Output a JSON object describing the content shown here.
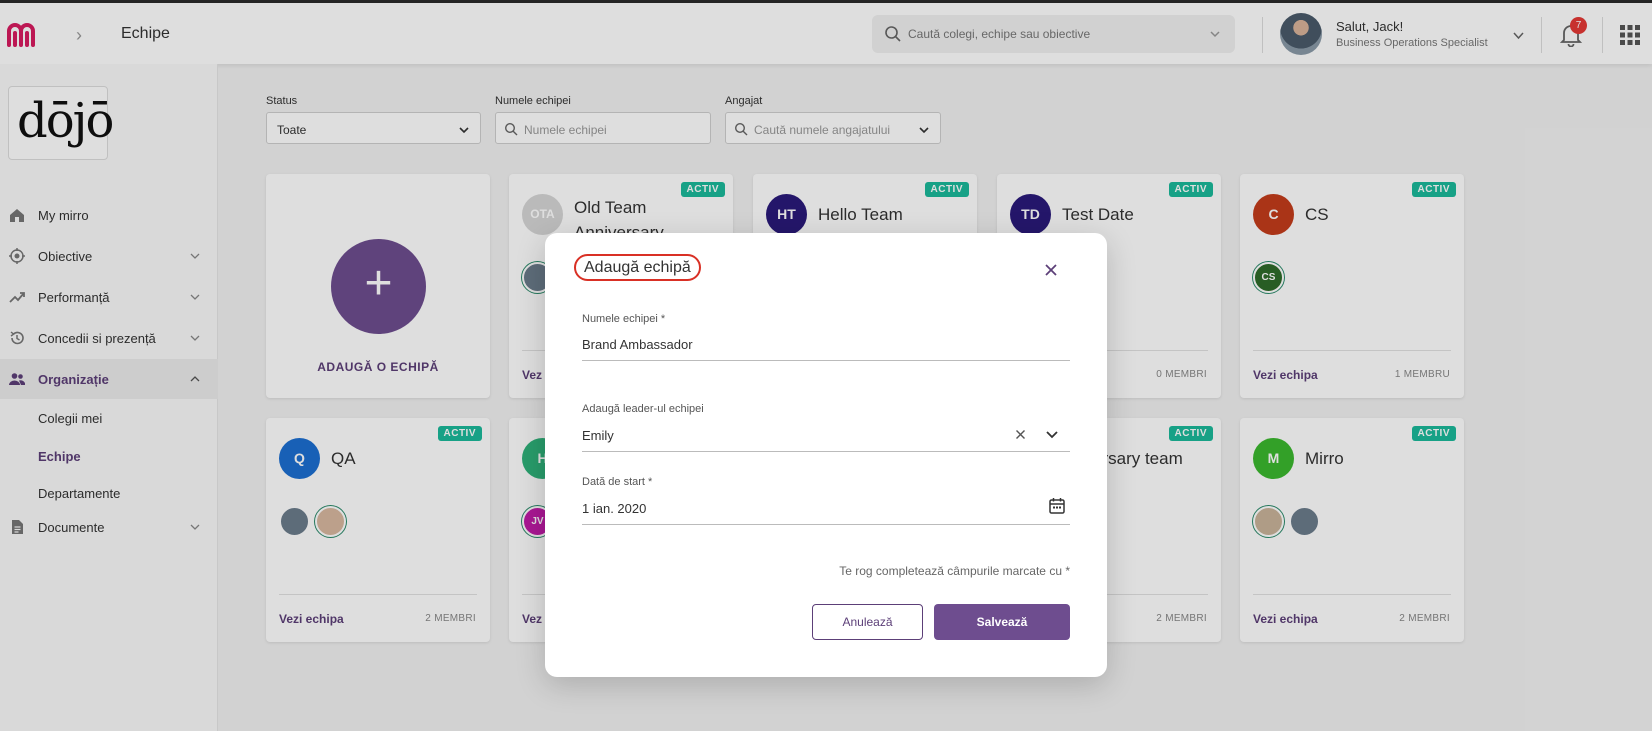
{
  "header": {
    "page_title": "Echipe",
    "search_placeholder": "Caută colegi, echipe sau obiective",
    "user_greeting": "Salut, Jack!",
    "user_role": "Business Operations Specialist",
    "notification_count": "7"
  },
  "sidebar": {
    "brand": "dōjō",
    "items": [
      {
        "label": "My mirro",
        "icon": "home-icon"
      },
      {
        "label": "Obiective",
        "icon": "target-icon"
      },
      {
        "label": "Performanță",
        "icon": "trending-icon"
      },
      {
        "label": "Concedii si prezență",
        "icon": "history-icon"
      },
      {
        "label": "Organizație",
        "icon": "people-icon"
      },
      {
        "label": "Documente",
        "icon": "document-icon"
      }
    ],
    "sub_items": [
      "Colegii mei",
      "Echipe",
      "Departamente"
    ]
  },
  "filters": {
    "status_label": "Status",
    "status_value": "Toate",
    "team_name_label": "Numele echipei",
    "team_name_placeholder": "Numele echipei",
    "employee_label": "Angajat",
    "employee_placeholder": "Caută numele angajatului"
  },
  "add_card": {
    "label": "ADAUGĂ O ECHIPĂ"
  },
  "cards": {
    "badge": "ACTIV",
    "view_link": "Vezi echipa",
    "old_team": {
      "initials": "OTA",
      "name": "Old Team Anniversary",
      "view": "Vez"
    },
    "hello_team": {
      "initials": "HT",
      "name": "Hello Team"
    },
    "test_date": {
      "initials": "TD",
      "name": "Test Date",
      "members": "0 MEMBRI"
    },
    "cs": {
      "initials": "C",
      "name": "CS",
      "member_initials": "CS",
      "members": "1 MEMBRU"
    },
    "qa": {
      "initials": "Q",
      "name": "QA",
      "members": "2 MEMBRI"
    },
    "h_team": {
      "initials": "H",
      "member_initials": "JV",
      "view": "Vez"
    },
    "anniv_team": {
      "name": "ersary team",
      "members": "2 MEMBRI"
    },
    "mirro": {
      "initials": "M",
      "name": "Mirro",
      "members": "2 MEMBRI"
    }
  },
  "modal": {
    "title": "Adaugă echipă",
    "team_name_label": "Numele echipei *",
    "team_name_value": "Brand Ambassador",
    "leader_label": "Adaugă leader-ul echipei",
    "leader_value": "Emily",
    "start_date_label": "Dată de start *",
    "start_date_value": "1 ian. 2020",
    "hint": "Te rog completează câmpurile marcate cu *",
    "cancel_label": "Anulează",
    "save_label": "Salvează"
  },
  "colors": {
    "brand": "#6e4d8f",
    "logo": "#d81b60",
    "active_badge": "#1bb99a",
    "highlight": "#d93025"
  }
}
